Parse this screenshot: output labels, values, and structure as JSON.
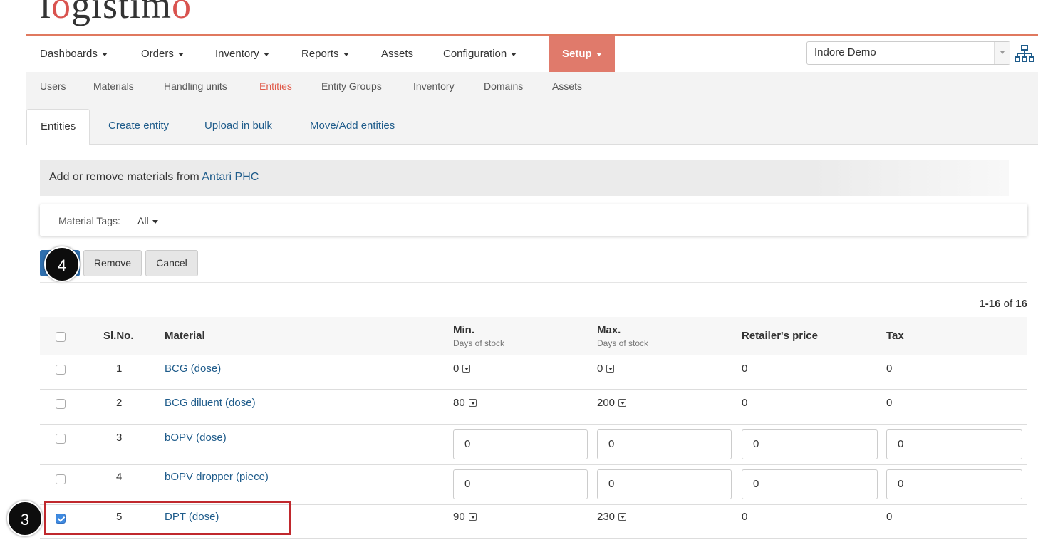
{
  "brand": {
    "logo_text_a": "l",
    "logo_text_o1": "o",
    "logo_text_mid": "gistim",
    "logo_text_o2": "o"
  },
  "mainnav": {
    "dashboards": "Dashboards",
    "orders": "Orders",
    "inventory": "Inventory",
    "reports": "Reports",
    "assets": "Assets",
    "configuration": "Configuration",
    "setup": "Setup"
  },
  "domain_select": {
    "value": "Indore Demo"
  },
  "subnav": {
    "users": "Users",
    "materials": "Materials",
    "handling_units": "Handling units",
    "entities": "Entities",
    "entity_groups": "Entity Groups",
    "inventory": "Inventory",
    "domains": "Domains",
    "assets": "Assets"
  },
  "tabs": {
    "entities": "Entities",
    "create_entity": "Create entity",
    "upload_in_bulk": "Upload in bulk",
    "move_add_entities": "Move/Add entities"
  },
  "panel": {
    "prefix": "Add or remove materials from ",
    "entity": "Antari PHC"
  },
  "filter": {
    "label": "Material Tags:",
    "value": "All"
  },
  "actions": {
    "remove": "Remove",
    "cancel": "Cancel"
  },
  "badges": {
    "step4": "4",
    "step3": "3"
  },
  "pager": {
    "range": "1-16",
    "of": "of",
    "total": "16"
  },
  "table": {
    "headers": {
      "slno": "Sl.No.",
      "material": "Material",
      "min": "Min.",
      "min_sub": "Days of stock",
      "max": "Max.",
      "max_sub": "Days of stock",
      "price": "Retailer's price",
      "tax": "Tax"
    },
    "rows": [
      {
        "no": "1",
        "material": "BCG (dose)",
        "min": "0",
        "max": "0",
        "price": "0",
        "tax": "0",
        "checked": false,
        "editing": false
      },
      {
        "no": "2",
        "material": "BCG diluent (dose)",
        "min": "80",
        "max": "200",
        "price": "0",
        "tax": "0",
        "checked": false,
        "editing": false
      },
      {
        "no": "3",
        "material": "bOPV (dose)",
        "min": "0",
        "max": "0",
        "price": "0",
        "tax": "0",
        "checked": false,
        "editing": true
      },
      {
        "no": "4",
        "material": "bOPV dropper (piece)",
        "min": "0",
        "max": "0",
        "price": "0",
        "tax": "0",
        "checked": false,
        "editing": true
      },
      {
        "no": "5",
        "material": "DPT (dose)",
        "min": "90",
        "max": "230",
        "price": "0",
        "tax": "0",
        "checked": true,
        "editing": false
      }
    ]
  },
  "colors": {
    "accent": "#e07a6b",
    "link": "#1f5c8b",
    "primary_button": "#2f6fae",
    "highlight": "#c0282d"
  }
}
